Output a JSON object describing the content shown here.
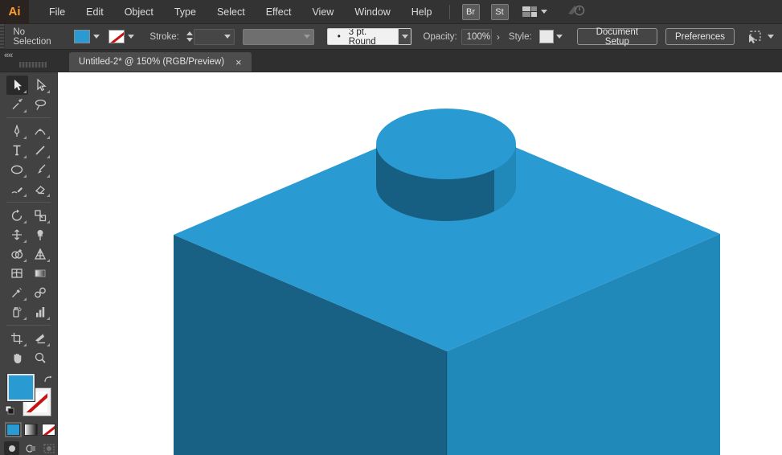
{
  "app": {
    "logo": "Ai",
    "menus": [
      "File",
      "Edit",
      "Object",
      "Type",
      "Select",
      "Effect",
      "View",
      "Window",
      "Help"
    ],
    "bridge_label": "Br",
    "stock_label": "St",
    "header_icons": [
      "workspace-switcher-icon",
      "touch-workspace-icon"
    ]
  },
  "control_bar": {
    "selection_status": "No Selection",
    "stroke_label": "Stroke:",
    "brush_bullet": "•",
    "brush_name": "3 pt. Round",
    "opacity_label": "Opacity:",
    "opacity_value": "100%",
    "opacity_arrow": "›",
    "style_label": "Style:",
    "document_setup_label": "Document Setup",
    "preferences_label": "Preferences"
  },
  "document_tab": {
    "title": "Untitled-2* @ 150% (RGB/Preview)",
    "close_glyph": "×"
  },
  "panel_dock": {
    "collapse_glyph": "««"
  },
  "toolbar": {
    "tools": [
      "selection-tool",
      "direct-selection-tool",
      "magic-wand-tool",
      "lasso-tool",
      "pen-tool",
      "curvature-tool",
      "type-tool",
      "line-segment-tool",
      "ellipse-tool",
      "paintbrush-tool",
      "shaper-tool",
      "eraser-tool",
      "rotate-tool",
      "scale-tool",
      "width-tool",
      "puppet-warp-tool",
      "shape-builder-tool",
      "perspective-grid-tool",
      "mesh-tool",
      "gradient-tool",
      "eyedropper-tool",
      "blend-tool",
      "symbol-sprayer-tool",
      "column-graph-tool",
      "artboard-tool",
      "slice-tool",
      "hand-tool",
      "zoom-tool"
    ],
    "active_tool": "selection-tool",
    "drawing_modes": [
      "draw-normal",
      "draw-behind",
      "draw-inside"
    ],
    "active_drawing_mode": "draw-normal"
  },
  "colors": {
    "fill_swatch": "#2A9AD3",
    "brick_top": "#2A9AD3",
    "brick_left": "#186084",
    "brick_right": "#2089BA",
    "stud_side": "#175E83",
    "stud_top": "#2A9AD3"
  }
}
